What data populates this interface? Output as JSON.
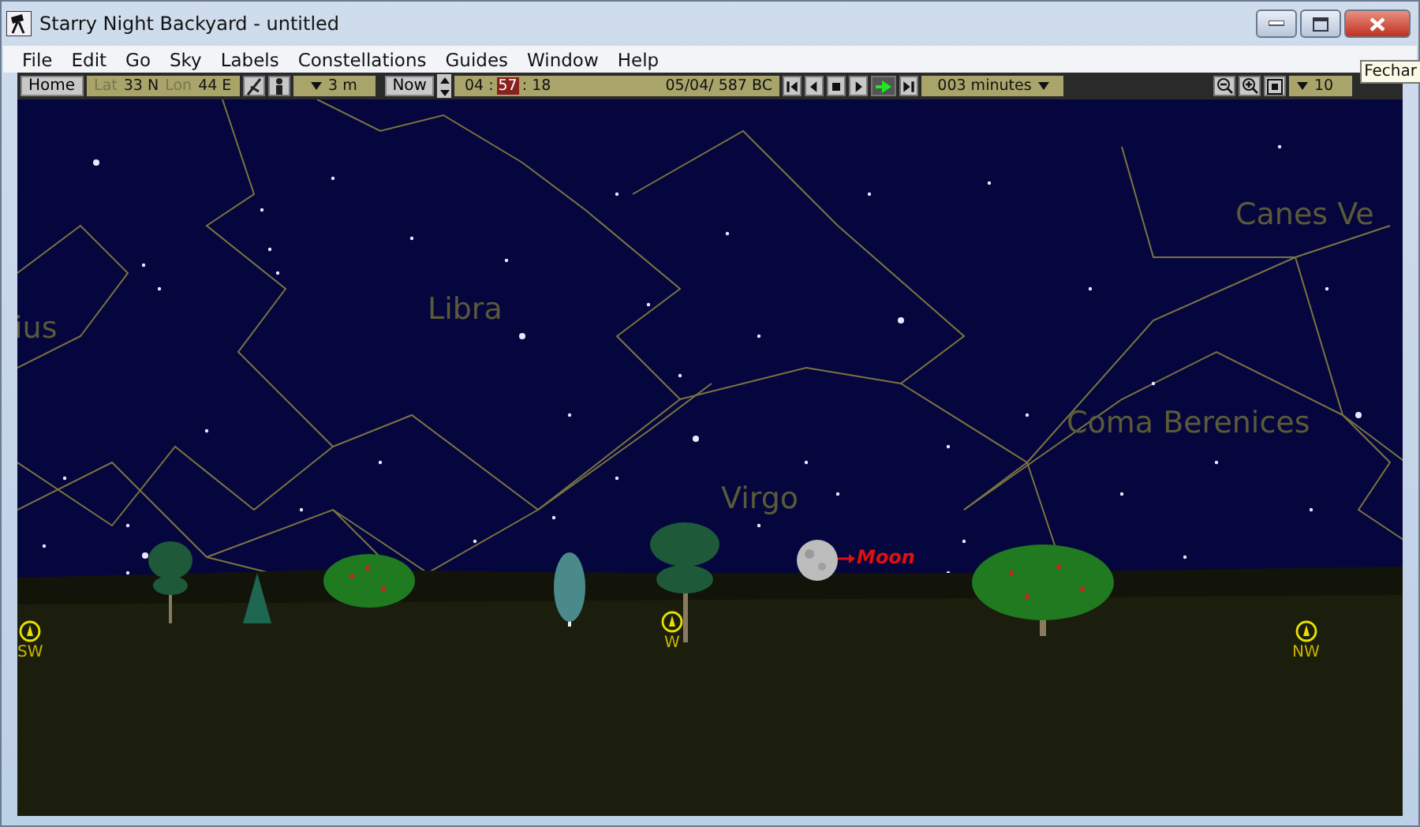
{
  "window": {
    "title": "Starry Night Backyard - untitled",
    "close_tooltip": "Fechar"
  },
  "menu": [
    "File",
    "Edit",
    "Go",
    "Sky",
    "Labels",
    "Constellations",
    "Guides",
    "Window",
    "Help"
  ],
  "toolbar": {
    "home": "Home",
    "lat_label": "Lat",
    "lat": "33 N",
    "lon_label": "Lon",
    "lon": "44 E",
    "elevation": "3 m",
    "now": "Now",
    "time_segments": [
      {
        "text": "04",
        "selected": false
      },
      {
        "text": "57",
        "selected": true
      },
      {
        "text": "18",
        "selected": false
      }
    ],
    "time_separator": ":",
    "date": "05/04/  587 BC",
    "playback": [
      {
        "kind": "step-back",
        "selected": false
      },
      {
        "kind": "back",
        "selected": false
      },
      {
        "kind": "stop",
        "selected": false
      },
      {
        "kind": "play",
        "selected": false
      },
      {
        "kind": "run",
        "selected": true
      },
      {
        "kind": "step-forward",
        "selected": false
      }
    ],
    "step": "003 minutes",
    "zoom": "10"
  },
  "sky": {
    "constellations": [
      "ius",
      "Libra",
      "Canes Ve",
      "Coma Berenices",
      "Virgo"
    ],
    "moon_label": "Moon",
    "compass": [
      "SW",
      "W",
      "NW"
    ]
  }
}
